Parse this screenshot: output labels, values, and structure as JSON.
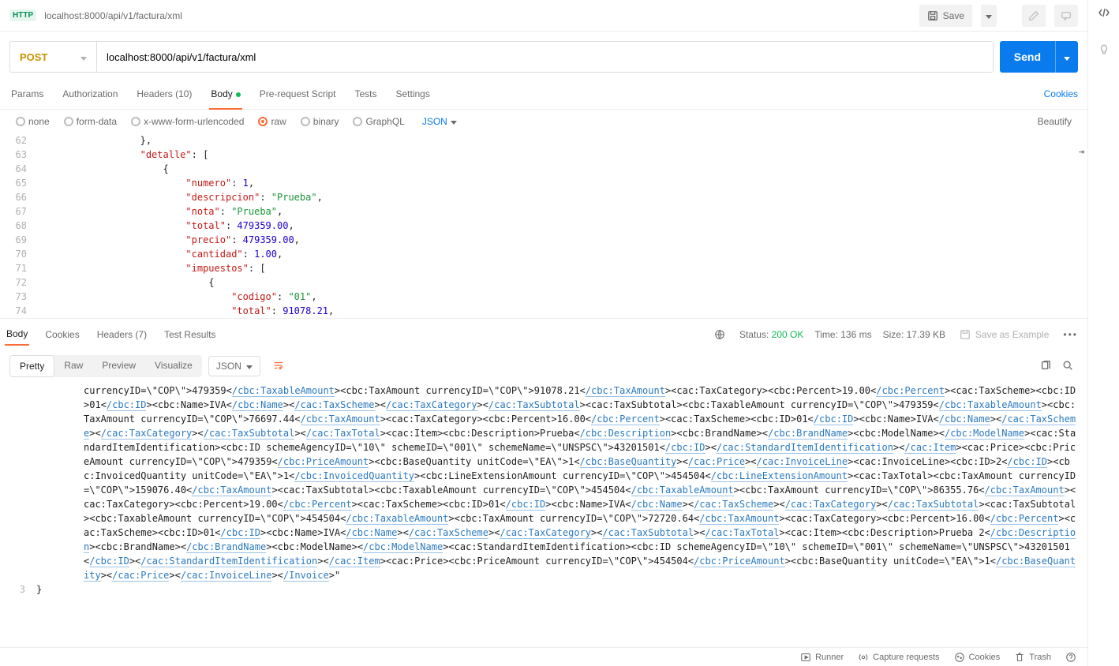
{
  "titlebar": {
    "http_chip": "HTTP",
    "title": "localhost:8000/api/v1/factura/xml",
    "save": "Save"
  },
  "request": {
    "method": "POST",
    "url": "localhost:8000/api/v1/factura/xml",
    "send": "Send"
  },
  "tabs": {
    "params": "Params",
    "auth": "Authorization",
    "headers": "Headers (10)",
    "body": "Body",
    "prereq": "Pre-request Script",
    "tests": "Tests",
    "settings": "Settings",
    "cookies": "Cookies"
  },
  "body_types": {
    "none": "none",
    "formdata": "form-data",
    "xwww": "x-www-form-urlencoded",
    "raw": "raw",
    "binary": "binary",
    "graphql": "GraphQL",
    "json": "JSON",
    "beautify": "Beautify"
  },
  "editor_lines": [
    {
      "n": 62,
      "indent": 4,
      "raw": "},"
    },
    {
      "n": 63,
      "indent": 4,
      "k": "\"detalle\"",
      "after": ": ["
    },
    {
      "n": 64,
      "indent": 5,
      "raw": "{"
    },
    {
      "n": 65,
      "indent": 6,
      "k": "\"numero\"",
      "after": ": ",
      "num": "1",
      "tail": ","
    },
    {
      "n": 66,
      "indent": 6,
      "k": "\"descripcion\"",
      "after": ": ",
      "str": "\"Prueba\"",
      "tail": ","
    },
    {
      "n": 67,
      "indent": 6,
      "k": "\"nota\"",
      "after": ": ",
      "str": "\"Prueba\"",
      "tail": ","
    },
    {
      "n": 68,
      "indent": 6,
      "k": "\"total\"",
      "after": ": ",
      "num": "479359.00",
      "tail": ","
    },
    {
      "n": 69,
      "indent": 6,
      "k": "\"precio\"",
      "after": ": ",
      "num": "479359.00",
      "tail": ","
    },
    {
      "n": 70,
      "indent": 6,
      "k": "\"cantidad\"",
      "after": ": ",
      "num": "1.00",
      "tail": ","
    },
    {
      "n": 71,
      "indent": 6,
      "k": "\"impuestos\"",
      "after": ": ["
    },
    {
      "n": 72,
      "indent": 7,
      "raw": "{"
    },
    {
      "n": 73,
      "indent": 8,
      "k": "\"codigo\"",
      "after": ": ",
      "str": "\"01\"",
      "tail": ","
    },
    {
      "n": 74,
      "indent": 8,
      "k": "\"total\"",
      "after": ": ",
      "num": "91078.21",
      "tail": ","
    }
  ],
  "resp_tabs": {
    "body": "Body",
    "cookies": "Cookies",
    "headers": "Headers (7)",
    "tests": "Test Results"
  },
  "resp_meta": {
    "status_l": "Status:",
    "status_v": "200 OK",
    "time": "Time: 136 ms",
    "size": "Size: 17.39 KB",
    "save_ex": "Save as Example"
  },
  "fmt": {
    "pretty": "Pretty",
    "raw": "Raw",
    "preview": "Preview",
    "visualize": "Visualize",
    "json": "JSON"
  },
  "resp_body_segments": [
    {
      "t": "currencyID=\\\"COP\\\">479359<"
    },
    {
      "tag": "/cbc:TaxableAmount"
    },
    {
      "t": "><cbc:TaxAmount currencyID=\\\"COP\\\">91078.21<"
    },
    {
      "tag": "/cbc:TaxAmount"
    },
    {
      "t": "><cac:TaxCategory><cbc:Percent>19.00<"
    },
    {
      "tag": "/cbc:Percent"
    },
    {
      "t": "><cac:TaxScheme><cbc:ID>01<"
    },
    {
      "tag": "/cbc:ID"
    },
    {
      "t": "><cbc:Name>IVA<"
    },
    {
      "tag": "/cbc:Name"
    },
    {
      "t": "><"
    },
    {
      "tag": "/cac:TaxScheme"
    },
    {
      "t": "><"
    },
    {
      "tag": "/cac:TaxCategory"
    },
    {
      "t": "><"
    },
    {
      "tag": "/cac:TaxSubtotal"
    },
    {
      "t": "><cac:TaxSubtotal><cbc:TaxableAmount currencyID=\\\"COP\\\">479359<"
    },
    {
      "tag": "/cbc:TaxableAmount"
    },
    {
      "t": "><cbc:TaxAmount currencyID=\\\"COP\\\">76697.44<"
    },
    {
      "tag": "/cbc:TaxAmount"
    },
    {
      "t": "><cac:TaxCategory><cbc:Percent>16.00<"
    },
    {
      "tag": "/cbc:Percent"
    },
    {
      "t": "><cac:TaxScheme><cbc:ID>01<"
    },
    {
      "tag": "/cbc:ID"
    },
    {
      "t": "><cbc:Name>IVA<"
    },
    {
      "tag": "/cbc:Name"
    },
    {
      "t": "><"
    },
    {
      "tag": "/cac:TaxScheme"
    },
    {
      "t": "><"
    },
    {
      "tag": "/cac:TaxCategory"
    },
    {
      "t": "><"
    },
    {
      "tag": "/cac:TaxSubtotal"
    },
    {
      "t": "><"
    },
    {
      "tag": "/cac:TaxTotal"
    },
    {
      "t": "><cac:Item><cbc:Description>Prueba<"
    },
    {
      "tag": "/cbc:Description"
    },
    {
      "t": "><cbc:BrandName><"
    },
    {
      "tag": "/cbc:BrandName"
    },
    {
      "t": "><cbc:ModelName><"
    },
    {
      "tag": "/cbc:ModelName"
    },
    {
      "t": "><cac:StandardItemIdentification><cbc:ID schemeAgencyID=\\\"10\\\" schemeID=\\\"001\\\" schemeName=\\\"UNSPSC\\\">43201501<"
    },
    {
      "tag": "/cbc:ID"
    },
    {
      "t": "><"
    },
    {
      "tag": "/cac:StandardItemIdentification"
    },
    {
      "t": "><"
    },
    {
      "tag": "/cac:Item"
    },
    {
      "t": "><cac:Price><cbc:PriceAmount currencyID=\\\"COP\\\">479359<"
    },
    {
      "tag": "/cbc:PriceAmount"
    },
    {
      "t": "><cbc:BaseQuantity unitCode=\\\"EA\\\">1<"
    },
    {
      "tag": "/cbc:BaseQuantity"
    },
    {
      "t": "><"
    },
    {
      "tag": "/cac:Price"
    },
    {
      "t": "><"
    },
    {
      "tag": "/cac:InvoiceLine"
    },
    {
      "t": "><cac:InvoiceLine><cbc:ID>2<"
    },
    {
      "tag": "/cbc:ID"
    },
    {
      "t": "><cbc:InvoicedQuantity unitCode=\\\"EA\\\">1<"
    },
    {
      "tag": "/cbc:InvoicedQuantity"
    },
    {
      "t": "><cbc:LineExtensionAmount currencyID=\\\"COP\\\">454504<"
    },
    {
      "tag": "/cbc:LineExtensionAmount"
    },
    {
      "t": "><cac:TaxTotal><cbc:TaxAmount currencyID=\\\"COP\\\">159076.40<"
    },
    {
      "tag": "/cbc:TaxAmount"
    },
    {
      "t": "><cac:TaxSubtotal><cbc:TaxableAmount currencyID=\\\"COP\\\">454504<"
    },
    {
      "tag": "/cbc:TaxableAmount"
    },
    {
      "t": "><cbc:TaxAmount currencyID=\\\"COP\\\">86355.76<"
    },
    {
      "tag": "/cbc:TaxAmount"
    },
    {
      "t": "><cac:TaxCategory><cbc:Percent>19.00<"
    },
    {
      "tag": "/cbc:Percent"
    },
    {
      "t": "><cac:TaxScheme><cbc:ID>01<"
    },
    {
      "tag": "/cbc:ID"
    },
    {
      "t": "><cbc:Name>IVA<"
    },
    {
      "tag": "/cbc:Name"
    },
    {
      "t": "><"
    },
    {
      "tag": "/cac:TaxScheme"
    },
    {
      "t": "><"
    },
    {
      "tag": "/cac:TaxCategory"
    },
    {
      "t": "><"
    },
    {
      "tag": "/cac:TaxSubtotal"
    },
    {
      "t": "><cac:TaxSubtotal><cbc:TaxableAmount currencyID=\\\"COP\\\">454504<"
    },
    {
      "tag": "/cbc:TaxableAmount"
    },
    {
      "t": "><cbc:TaxAmount currencyID=\\\"COP\\\">72720.64<"
    },
    {
      "tag": "/cbc:TaxAmount"
    },
    {
      "t": "><cac:TaxCategory><cbc:Percent>16.00<"
    },
    {
      "tag": "/cbc:Percent"
    },
    {
      "t": "><cac:TaxScheme><cbc:ID>01<"
    },
    {
      "tag": "/cbc:ID"
    },
    {
      "t": "><cbc:Name>IVA<"
    },
    {
      "tag": "/cbc:Name"
    },
    {
      "t": "><"
    },
    {
      "tag": "/cac:TaxScheme"
    },
    {
      "t": "><"
    },
    {
      "tag": "/cac:TaxCategory"
    },
    {
      "t": "><"
    },
    {
      "tag": "/cac:TaxSubtotal"
    },
    {
      "t": "><"
    },
    {
      "tag": "/cac:TaxTotal"
    },
    {
      "t": "><cac:Item><cbc:Description>Prueba 2<"
    },
    {
      "tag": "/cbc:Description"
    },
    {
      "t": "><cbc:BrandName><"
    },
    {
      "tag": "/cbc:BrandName"
    },
    {
      "t": "><cbc:ModelName><"
    },
    {
      "tag": "/cbc:ModelName"
    },
    {
      "t": "><cac:StandardItemIdentification><cbc:ID schemeAgencyID=\\\"10\\\" schemeID=\\\"001\\\" schemeName=\\\"UNSPSC\\\">43201501<"
    },
    {
      "tag": "/cbc:ID"
    },
    {
      "t": "><"
    },
    {
      "tag": "/cac:StandardItemIdentification"
    },
    {
      "t": "><"
    },
    {
      "tag": "/cac:Item"
    },
    {
      "t": "><cac:Price><cbc:PriceAmount currencyID=\\\"COP\\\">454504<"
    },
    {
      "tag": "/cbc:PriceAmount"
    },
    {
      "t": "><cbc:BaseQuantity unitCode=\\\"EA\\\">1<"
    },
    {
      "tag": "/cbc:BaseQuantity"
    },
    {
      "t": "><"
    },
    {
      "tag": "/cac:Price"
    },
    {
      "t": "><"
    },
    {
      "tag": "/cac:InvoiceLine"
    },
    {
      "t": "><"
    },
    {
      "tag": "/Invoice"
    },
    {
      "t": ">\""
    }
  ],
  "resp_line3": {
    "gutter": "3",
    "content": "}"
  },
  "statusbar": {
    "runner": "Runner",
    "capture": "Capture requests",
    "cookies": "Cookies",
    "trash": "Trash"
  }
}
